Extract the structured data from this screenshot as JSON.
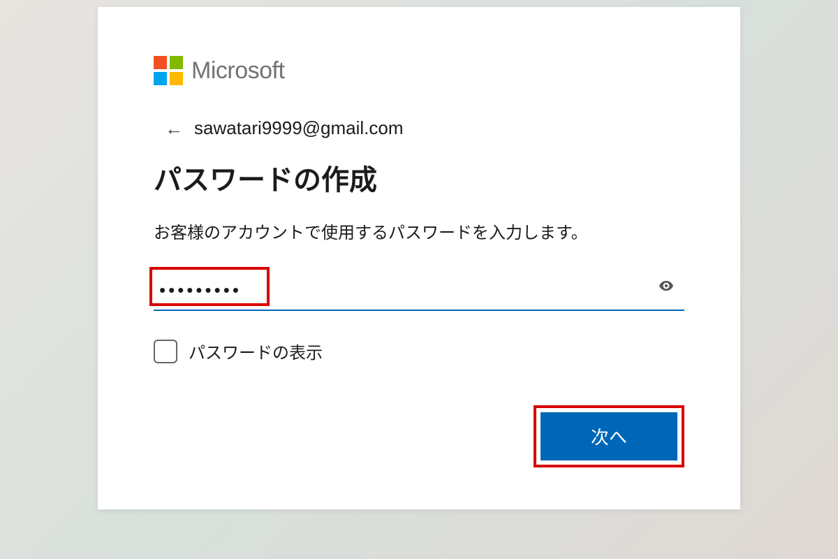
{
  "brand": "Microsoft",
  "account_email": "sawatari9999@gmail.com",
  "title": "パスワードの作成",
  "description": "お客様のアカウントで使用するパスワードを入力します。",
  "password_value": "•••••••••",
  "show_password_label": "パスワードの表示",
  "next_button_label": "次へ",
  "colors": {
    "primary": "#0067b8",
    "highlight": "#d80000"
  }
}
